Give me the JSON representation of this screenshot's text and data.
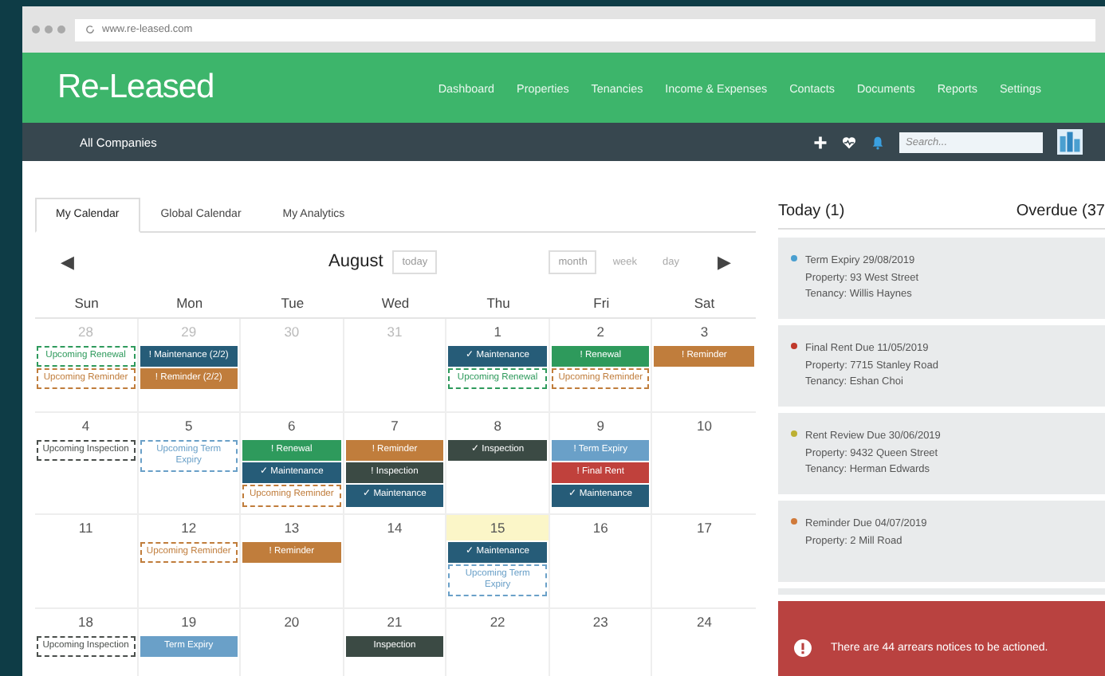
{
  "browser": {
    "url": "www.re-leased.com"
  },
  "header": {
    "logo": "Re-Leased",
    "nav": [
      "Dashboard",
      "Properties",
      "Tenancies",
      "Income & Expenses",
      "Contacts",
      "Documents",
      "Reports",
      "Settings"
    ]
  },
  "toolbar": {
    "company": "All Companies",
    "search": {
      "placeholder": "Search..."
    }
  },
  "tabs": [
    {
      "label": "My Calendar",
      "selected": true
    },
    {
      "label": "Global Calendar",
      "selected": false
    },
    {
      "label": "My Analytics",
      "selected": false
    }
  ],
  "calendar": {
    "prev": "◀",
    "next": "▶",
    "month": "August",
    "today_button": "today",
    "views": [
      {
        "label": "month",
        "selected": true
      },
      {
        "label": "week",
        "selected": false
      },
      {
        "label": "day",
        "selected": false
      }
    ],
    "weekdays": [
      "Sun",
      "Mon",
      "Tue",
      "Wed",
      "Thu",
      "Fri",
      "Sat"
    ],
    "weeks": [
      [
        {
          "day": "28",
          "muted": true,
          "today": false,
          "events": [
            {
              "kind": "upcoming",
              "label": "Upcoming Renewal",
              "color": "#2e9a5c"
            },
            {
              "kind": "upcoming",
              "label": "Upcoming Reminder",
              "color": "#c07d3c"
            }
          ]
        },
        {
          "day": "29",
          "muted": true,
          "today": false,
          "events": [
            {
              "kind": "solid",
              "label": "! Maintenance (2/2)",
              "color": "#265c78"
            },
            {
              "kind": "solid",
              "label": "! Reminder (2/2)",
              "color": "#c07d3c"
            }
          ]
        },
        {
          "day": "30",
          "muted": true,
          "today": false
        },
        {
          "day": "31",
          "muted": true,
          "today": false
        },
        {
          "day": "1",
          "muted": false,
          "today": false,
          "events": [
            {
              "kind": "solid",
              "label": "✓ Maintenance",
              "color": "#265c78"
            },
            {
              "kind": "upcoming",
              "label": "Upcoming Renewal",
              "color": "#2e9a5c"
            }
          ]
        },
        {
          "day": "2",
          "muted": false,
          "today": false,
          "events": [
            {
              "kind": "solid",
              "label": "! Renewal",
              "color": "#2e9a5c"
            },
            {
              "kind": "upcoming",
              "label": "Upcoming Reminder",
              "color": "#c07d3c"
            }
          ]
        },
        {
          "day": "3",
          "muted": false,
          "today": false,
          "events": [
            {
              "kind": "solid",
              "label": "! Reminder",
              "color": "#c07d3c"
            }
          ]
        }
      ],
      [
        {
          "day": "4",
          "muted": false,
          "today": false,
          "events": [
            {
              "kind": "upcoming",
              "label": "Upcoming Inspection",
              "color": "#4a4f4c"
            }
          ]
        },
        {
          "day": "5",
          "muted": false,
          "today": false,
          "events": [
            {
              "kind": "upcoming",
              "label": "Upcoming Term Expiry",
              "color": "#6aa0c8"
            }
          ]
        },
        {
          "day": "6",
          "muted": false,
          "today": false,
          "events": [
            {
              "kind": "solid",
              "label": "! Renewal",
              "color": "#2e9a5c"
            },
            {
              "kind": "solid",
              "label": "✓ Maintenance",
              "color": "#265c78"
            },
            {
              "kind": "upcoming",
              "label": "Upcoming Reminder",
              "color": "#c07d3c"
            }
          ]
        },
        {
          "day": "7",
          "muted": false,
          "today": false,
          "events": [
            {
              "kind": "solid",
              "label": "! Reminder",
              "color": "#c07d3c"
            },
            {
              "kind": "solid",
              "label": "! Inspection",
              "color": "#3b4a44"
            },
            {
              "kind": "solid",
              "label": "✓ Maintenance",
              "color": "#265c78"
            }
          ]
        },
        {
          "day": "8",
          "muted": false,
          "today": false,
          "events": [
            {
              "kind": "solid",
              "label": "✓ Inspection",
              "color": "#3b4a44"
            }
          ]
        },
        {
          "day": "9",
          "muted": false,
          "today": false,
          "events": [
            {
              "kind": "solid",
              "label": "! Term Expiry",
              "color": "#6aa0c8"
            },
            {
              "kind": "solid",
              "label": "! Final Rent",
              "color": "#c0413c"
            },
            {
              "kind": "solid",
              "label": "✓ Maintenance",
              "color": "#265c78"
            }
          ]
        },
        {
          "day": "10",
          "muted": false,
          "today": false
        }
      ],
      [
        {
          "day": "11",
          "muted": false,
          "today": false
        },
        {
          "day": "12",
          "muted": false,
          "today": false,
          "events": [
            {
              "kind": "upcoming",
              "label": "Upcoming Reminder",
              "color": "#c07d3c"
            }
          ]
        },
        {
          "day": "13",
          "muted": false,
          "today": false,
          "events": [
            {
              "kind": "solid",
              "label": "! Reminder",
              "color": "#c07d3c"
            }
          ]
        },
        {
          "day": "14",
          "muted": false,
          "today": false
        },
        {
          "day": "15",
          "muted": false,
          "today": true,
          "events": [
            {
              "kind": "solid",
              "label": "✓ Maintenance",
              "color": "#265c78"
            },
            {
              "kind": "upcoming",
              "label": "Upcoming Term Expiry",
              "color": "#6aa0c8"
            }
          ]
        },
        {
          "day": "16",
          "muted": false,
          "today": false
        },
        {
          "day": "17",
          "muted": false,
          "today": false
        }
      ],
      [
        {
          "day": "18",
          "muted": false,
          "today": false,
          "events": [
            {
              "kind": "upcoming",
              "label": "Upcoming Inspection",
              "color": "#4a4f4c"
            }
          ]
        },
        {
          "day": "19",
          "muted": false,
          "today": false,
          "events": [
            {
              "kind": "solid",
              "label": "Term Expiry",
              "color": "#6aa0c8"
            }
          ]
        },
        {
          "day": "20",
          "muted": false,
          "today": false
        },
        {
          "day": "21",
          "muted": false,
          "today": false,
          "events": [
            {
              "kind": "solid",
              "label": "Inspection",
              "color": "#3b4a44"
            }
          ]
        },
        {
          "day": "22",
          "muted": false,
          "today": false
        },
        {
          "day": "23",
          "muted": false,
          "today": false
        },
        {
          "day": "24",
          "muted": false,
          "today": false
        }
      ]
    ]
  },
  "panel": {
    "today_title": "Today (1)",
    "overdue_title": "Overdue (37",
    "items": [
      {
        "color": "#4a9fd0",
        "lines": [
          "Term Expiry 29/08/2019",
          "Property: 93 West Street",
          "Tenancy: Willis Haynes"
        ]
      },
      {
        "color": "#c0392b",
        "lines": [
          "Final Rent Due 11/05/2019",
          "Property: 7715 Stanley Road",
          "Tenancy: Eshan Choi"
        ]
      },
      {
        "color": "#bdb032",
        "lines": [
          "Rent Review Due 30/06/2019",
          "Property: 9432 Queen Street",
          "Tenancy: Herman Edwards"
        ]
      },
      {
        "color": "#d07a3a",
        "lines": [
          "Reminder Due 04/07/2019",
          "Property: 2 Mill Road"
        ]
      }
    ],
    "alert": "There are 44 arrears notices to be actioned."
  }
}
